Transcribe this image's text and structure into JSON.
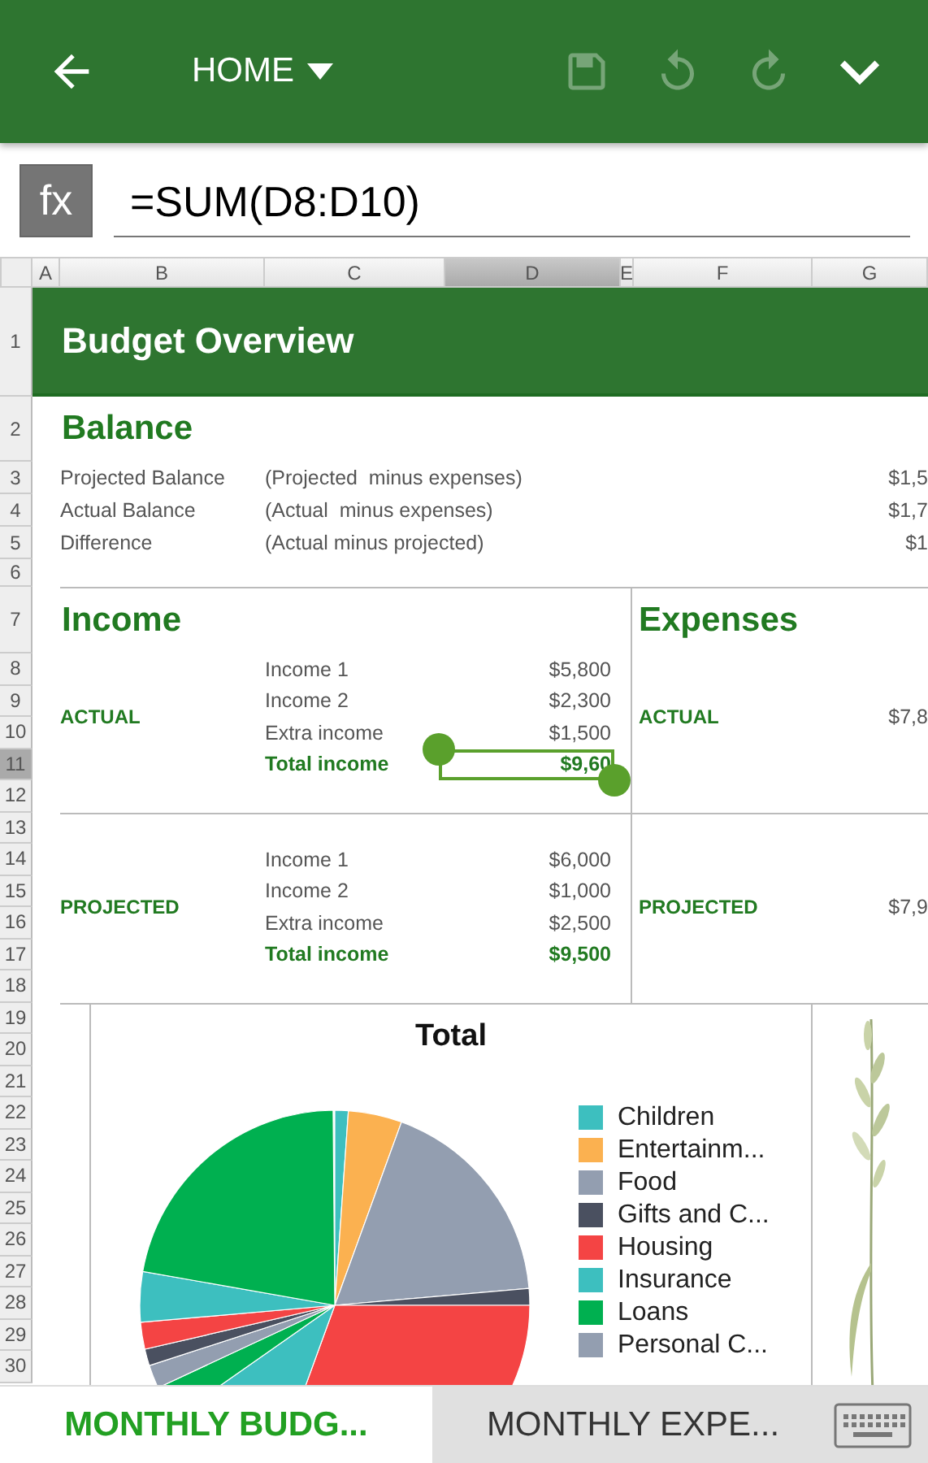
{
  "toolbar": {
    "menu": "HOME",
    "actions": [
      {
        "kind": "save",
        "disabled": true
      },
      {
        "kind": "undo",
        "disabled": true
      },
      {
        "kind": "redo",
        "disabled": true
      }
    ]
  },
  "formula_bar": {
    "label": "fx",
    "value": "=SUM(D8:D10)"
  },
  "columns": [
    {
      "label": "A",
      "selected": false
    },
    {
      "label": "B",
      "selected": false
    },
    {
      "label": "C",
      "selected": false
    },
    {
      "label": "D",
      "selected": true
    },
    {
      "label": "E",
      "selected": false
    },
    {
      "label": "F",
      "selected": false
    },
    {
      "label": "G",
      "selected": false
    }
  ],
  "rows": [
    {
      "label": "1",
      "selected": false
    },
    {
      "label": "2",
      "selected": false
    },
    {
      "label": "3",
      "selected": false
    },
    {
      "label": "4",
      "selected": false
    },
    {
      "label": "5",
      "selected": false
    },
    {
      "label": "6",
      "selected": false
    },
    {
      "label": "7",
      "selected": false
    },
    {
      "label": "8",
      "selected": false
    },
    {
      "label": "9",
      "selected": false
    },
    {
      "label": "10",
      "selected": false
    },
    {
      "label": "11",
      "selected": true
    },
    {
      "label": "12",
      "selected": false
    },
    {
      "label": "13",
      "selected": false
    },
    {
      "label": "14",
      "selected": false
    },
    {
      "label": "15",
      "selected": false
    },
    {
      "label": "16",
      "selected": false
    },
    {
      "label": "17",
      "selected": false
    },
    {
      "label": "18",
      "selected": false
    },
    {
      "label": "19",
      "selected": false
    },
    {
      "label": "20",
      "selected": false
    },
    {
      "label": "21",
      "selected": false
    },
    {
      "label": "22",
      "selected": false
    },
    {
      "label": "23",
      "selected": false
    },
    {
      "label": "24",
      "selected": false
    },
    {
      "label": "25",
      "selected": false
    },
    {
      "label": "26",
      "selected": false
    },
    {
      "label": "27",
      "selected": false
    },
    {
      "label": "28",
      "selected": false
    },
    {
      "label": "29",
      "selected": false
    },
    {
      "label": "30",
      "selected": false
    }
  ],
  "sheet": {
    "title": "Budget Overview",
    "balance": {
      "heading": "Balance",
      "lines": [
        {
          "label": "Projected Balance",
          "note": "(Projected  minus expenses)",
          "value": "$1,5"
        },
        {
          "label": "Actual Balance",
          "note": "(Actual  minus expenses)",
          "value": "$1,7"
        },
        {
          "label": "Difference",
          "note": "(Actual minus projected)",
          "value": "$1"
        }
      ]
    },
    "income": {
      "heading": "Income",
      "groups": [
        {
          "label": "ACTUAL",
          "items": [
            {
              "kind": "item",
              "label": "Income 1",
              "value": "$5,800"
            },
            {
              "kind": "item",
              "label": "Income 2",
              "value": "$2,300"
            },
            {
              "kind": "item",
              "label": "Extra income",
              "value": "$1,500"
            },
            {
              "kind": "total",
              "label": "Total income",
              "value": "$9,60"
            }
          ]
        },
        {
          "label": "PROJECTED",
          "items": [
            {
              "kind": "item",
              "label": "Income 1",
              "value": "$6,000"
            },
            {
              "kind": "item",
              "label": "Income 2",
              "value": "$1,000"
            },
            {
              "kind": "item",
              "label": "Extra income",
              "value": "$2,500"
            },
            {
              "kind": "total",
              "label": "Total income",
              "value": "$9,500"
            }
          ]
        }
      ]
    },
    "expenses": {
      "heading": "Expenses",
      "groups": [
        {
          "label": "ACTUAL",
          "value": "$7,8"
        },
        {
          "label": "PROJECTED",
          "value": "$7,9"
        }
      ]
    },
    "chart": {
      "title": "Total",
      "legend": [
        {
          "label": "Children",
          "color": "#3dbfbf"
        },
        {
          "label": "Entertainm...",
          "color": "#fbb150"
        },
        {
          "label": "Food",
          "color": "#939eb0"
        },
        {
          "label": "Gifts and C...",
          "color": "#4a5060"
        },
        {
          "label": "Housing",
          "color": "#f44444"
        },
        {
          "label": "Insurance",
          "color": "#3dbfbf"
        },
        {
          "label": "Loans",
          "color": "#00b050"
        },
        {
          "label": "Personal C...",
          "color": "#939eb0"
        }
      ]
    }
  },
  "sheet_tabs": [
    {
      "label": "MONTHLY BUDG...",
      "selected": true
    },
    {
      "label": "MONTHLY EXPE...",
      "selected": false
    }
  ]
}
